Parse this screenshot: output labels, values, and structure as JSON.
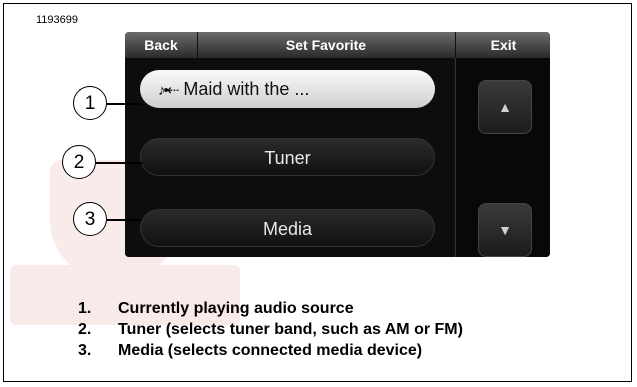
{
  "figure_id": "1193699",
  "screen": {
    "top_bar": {
      "back_label": "Back",
      "title": "Set Favorite",
      "exit_label": "Exit"
    },
    "items": [
      {
        "icon": "music-usb-icon",
        "icon_glyph": "♪•⇠",
        "label": "Maid with the ...",
        "selected": true
      },
      {
        "label": "Tuner",
        "selected": false
      },
      {
        "label": "Media",
        "selected": false
      }
    ],
    "scroll": {
      "up_glyph": "▲",
      "down_glyph": "▼"
    }
  },
  "callouts": [
    "1",
    "2",
    "3"
  ],
  "legend": [
    {
      "num": "1.",
      "text": "Currently playing audio source"
    },
    {
      "num": "2.",
      "text": "Tuner (selects tuner band, such as AM or FM)"
    },
    {
      "num": "3.",
      "text": "Media (selects connected media device)"
    }
  ],
  "colors": {
    "screen_bg": "#111111",
    "selected_item": "#e6e6e6",
    "item_text": "#e8e8e8"
  }
}
